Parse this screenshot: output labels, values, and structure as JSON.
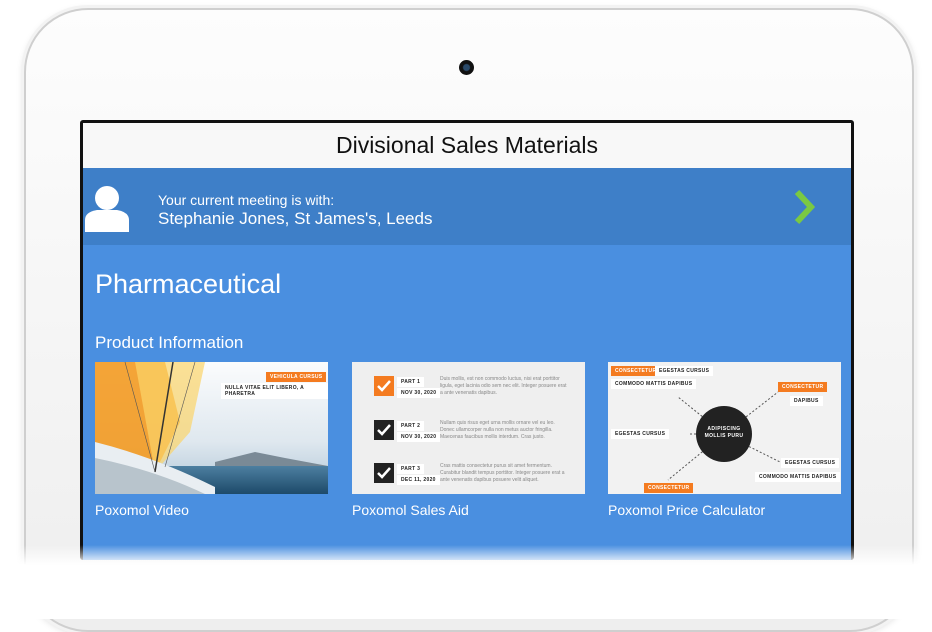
{
  "app": {
    "title": "Divisional Sales Materials"
  },
  "meeting": {
    "label": "Your current meeting is with:",
    "attendee": "Stephanie Jones, St James's, Leeds"
  },
  "section": {
    "title": "Pharmaceutical",
    "subtitle": "Product Information"
  },
  "items": [
    {
      "title": "Poxomol Video",
      "tags": [
        "VEHICULA CURSUS",
        "NULLA VITAE ELIT LIBERO, A PHARETRA"
      ]
    },
    {
      "title": "Poxomol Sales Aid",
      "rows": [
        {
          "part": "PART 1",
          "date": "NOV 30, 2020",
          "text": "Duis mollis, est non commodo luctus, nisi erat porttitor ligula, eget lacinia odio sem nec elit. Integer posuere erat a ante venenatis dapibus."
        },
        {
          "part": "PART 2",
          "date": "NOV 30, 2020",
          "text": "Nullam quis risus eget urna mollis ornare vel eu leo. Donec ullamcorper nulla non metus auctor fringilla. Maecenas faucibus mollis interdum. Cras justo."
        },
        {
          "part": "PART 3",
          "date": "DEC 11, 2020",
          "text": "Cras mattis consectetur purus sit amet fermentum. Curabitur blandit tempus porttitor. Integer posuere erat a ante venenatis dapibus posuere velit aliquet."
        }
      ]
    },
    {
      "title": "Poxomol Price Calculator",
      "center": "ADIPISCING MOLLIS PURU",
      "nodes": [
        "CONSECTETUR",
        "EGESTAS CURSUS",
        "COMMODO MATTIS DAPIBUS",
        "CONSECTETUR",
        "DAPIBUS",
        "EGESTAS CURSUS",
        "EGESTAS CURSUS",
        "COMMODO MATTIS DAPIBUS",
        "CONSECTETUR"
      ]
    }
  ],
  "colors": {
    "header_blue": "#3e7fc8",
    "content_blue": "#4a8fe0",
    "accent_green": "#7ac943",
    "tag_orange": "#f47b20"
  },
  "icons": {
    "avatar": "user-silhouette-icon",
    "next": "chevron-right-icon"
  }
}
